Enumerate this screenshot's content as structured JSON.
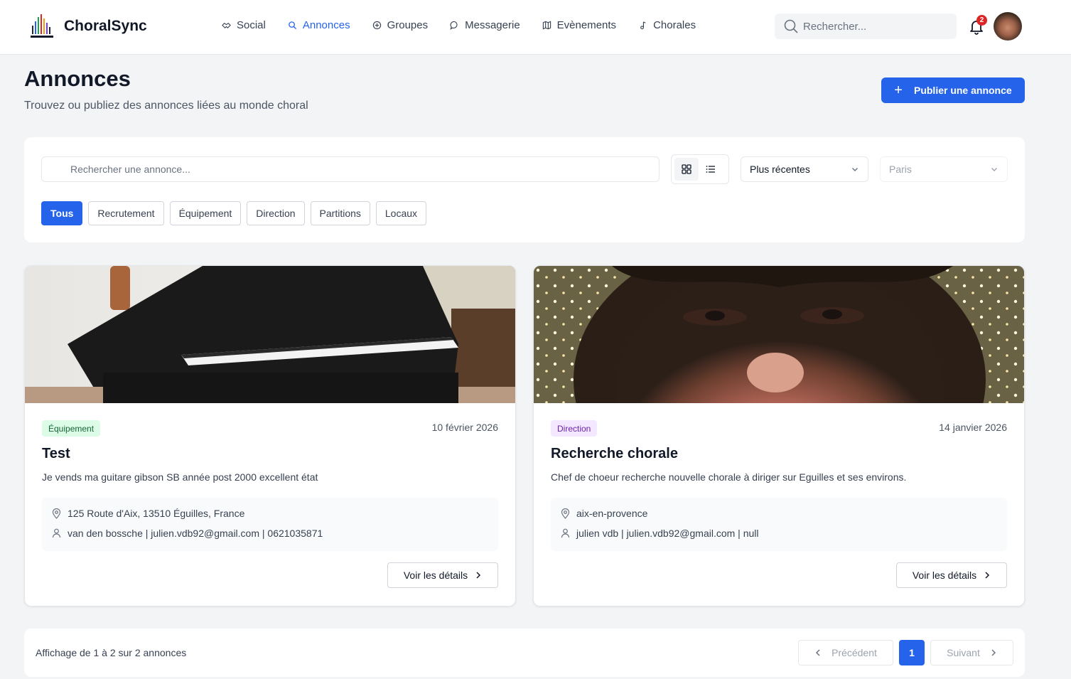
{
  "header": {
    "brand": "ChoralSync",
    "nav": [
      {
        "label": "Social",
        "icon": "handshake-icon"
      },
      {
        "label": "Annonces",
        "icon": "search-icon"
      },
      {
        "label": "Groupes",
        "icon": "circle-plus-icon"
      },
      {
        "label": "Messagerie",
        "icon": "chat-bubble-icon"
      },
      {
        "label": "Evènements",
        "icon": "map-icon"
      },
      {
        "label": "Chorales",
        "icon": "music-note-icon"
      }
    ],
    "active_nav": "Annonces",
    "search_placeholder": "Rechercher...",
    "notification_count": "2"
  },
  "page": {
    "title": "Annonces",
    "subtitle": "Trouvez ou publiez des annonces liées au monde choral",
    "publish_label": "Publier une annonce"
  },
  "filters": {
    "search_placeholder": "Rechercher une annonce...",
    "view_mode": "grid",
    "sort_value": "Plus récentes",
    "city_placeholder": "Paris",
    "categories": [
      "Tous",
      "Recrutement",
      "Équipement",
      "Direction",
      "Partitions",
      "Locaux"
    ],
    "active_category": "Tous"
  },
  "listings": [
    {
      "category": "Équipement",
      "date": "10 février 2026",
      "title": "Test",
      "description": "Je vends ma guitare gibson SB année post 2000 excellent état",
      "location": "125 Route d'Aix, 13510 Éguilles, France",
      "contact": "van den bossche | julien.vdb92@gmail.com | 0621035871",
      "details_label": "Voir les détails"
    },
    {
      "category": "Direction",
      "date": "14 janvier 2026",
      "title": "Recherche chorale",
      "description": "Chef de choeur recherche nouvelle chorale à diriger sur Eguilles et ses environs.",
      "location": "aix-en-provence",
      "contact": "julien vdb | julien.vdb92@gmail.com | null",
      "details_label": "Voir les détails"
    }
  ],
  "pagination": {
    "summary": "Affichage de 1 à 2 sur 2 annonces",
    "prev_label": "Précédent",
    "current_page": "1",
    "next_label": "Suivant"
  },
  "colors": {
    "primary": "#2563eb",
    "badge_equipment_bg": "#dcfce7",
    "badge_direction_bg": "#f3e8ff"
  }
}
